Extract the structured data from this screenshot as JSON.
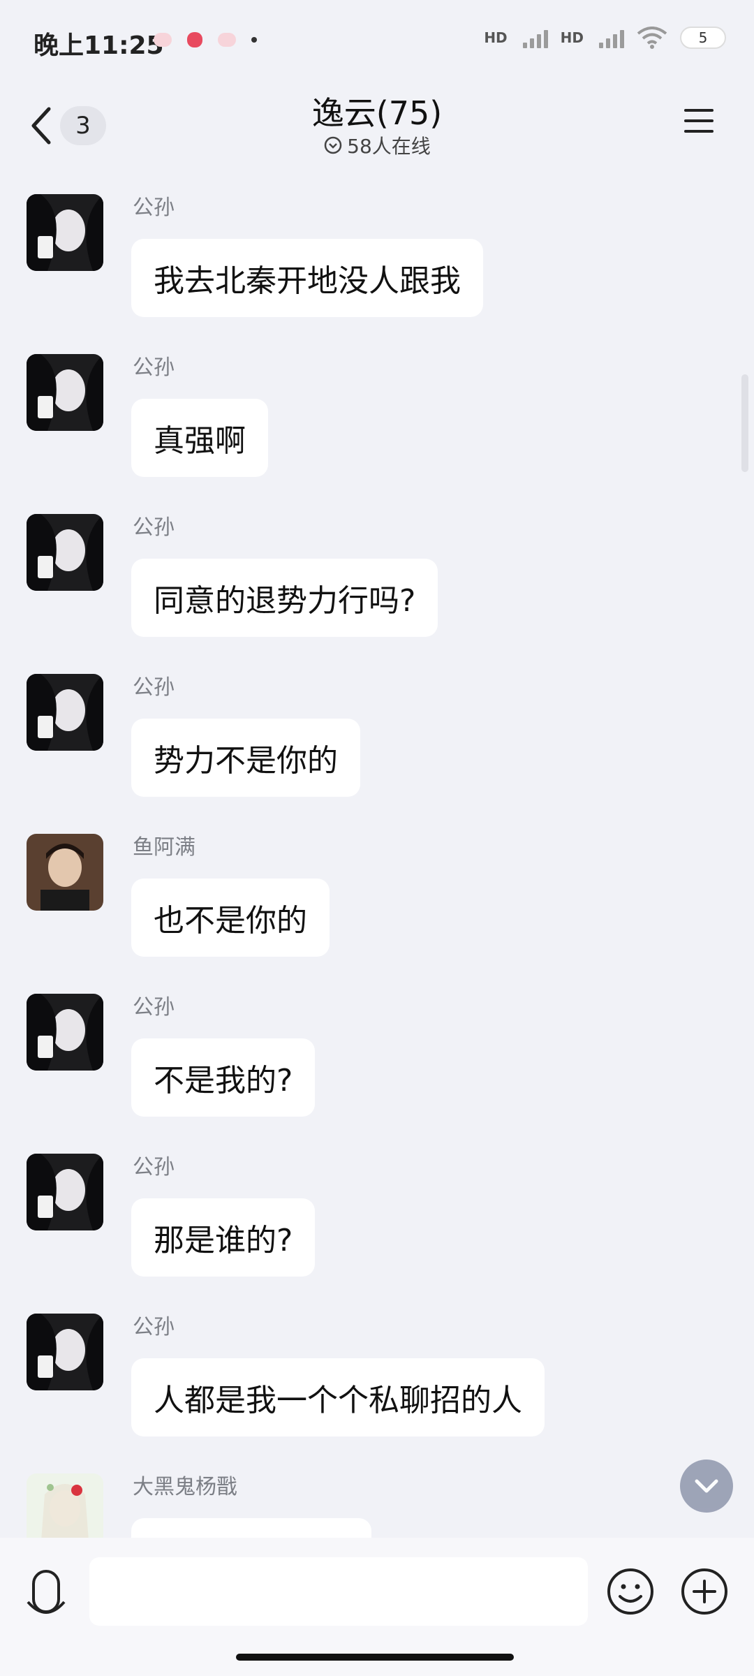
{
  "status_bar": {
    "time": "晚上11:25",
    "signal_label_1": "HD",
    "signal_label_2": "HD",
    "battery": "5"
  },
  "header": {
    "unread_count": "3",
    "title": "逸云(75)",
    "subtitle": "58人在线"
  },
  "messages": [
    {
      "sender": "公孙",
      "text": "我去北秦开地没人跟我"
    },
    {
      "sender": "公孙",
      "text": "真强啊"
    },
    {
      "sender": "公孙",
      "text": "同意的退势力行吗?"
    },
    {
      "sender": "公孙",
      "text": "势力不是你的"
    },
    {
      "sender": "鱼阿满",
      "text": "也不是你的"
    },
    {
      "sender": "公孙",
      "text": "不是我的?"
    },
    {
      "sender": "公孙",
      "text": "那是谁的?"
    },
    {
      "sender": "公孙",
      "text": "人都是我一个个私聊招的人"
    },
    {
      "sender": "大黑鬼杨戬",
      "text": ""
    }
  ],
  "colors": {
    "background": "#f1f2f7",
    "bubble": "#ffffff",
    "sender": "#7c7f86"
  },
  "icons": [
    "back-chevron-icon",
    "chevron-down-circle-icon",
    "menu-icon",
    "voice-icon",
    "emoji-icon",
    "plus-icon",
    "scroll-down-icon"
  ]
}
